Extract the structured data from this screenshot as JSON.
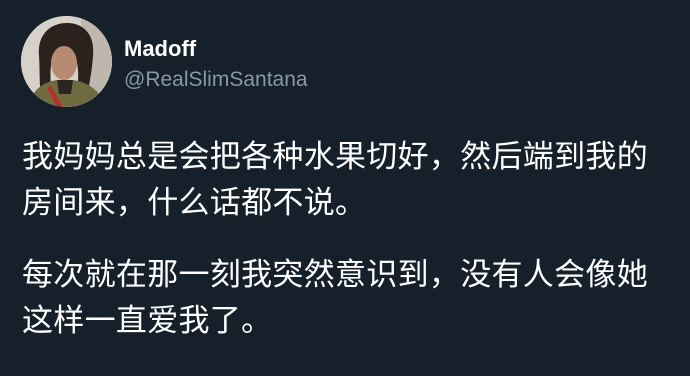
{
  "tweet": {
    "avatar": "profile-photo",
    "display_name": "Madoff",
    "handle": "@RealSlimSantana",
    "paragraphs": [
      "我妈妈总是会把各种水果切好，然后端到我的房间来，什么话都不说。",
      "每次就在那一刻我突然意识到，没有人会像她这样一直爱我了。"
    ]
  },
  "colors": {
    "background": "#15202b",
    "text": "#ffffff",
    "secondary_text": "#8899a6"
  }
}
